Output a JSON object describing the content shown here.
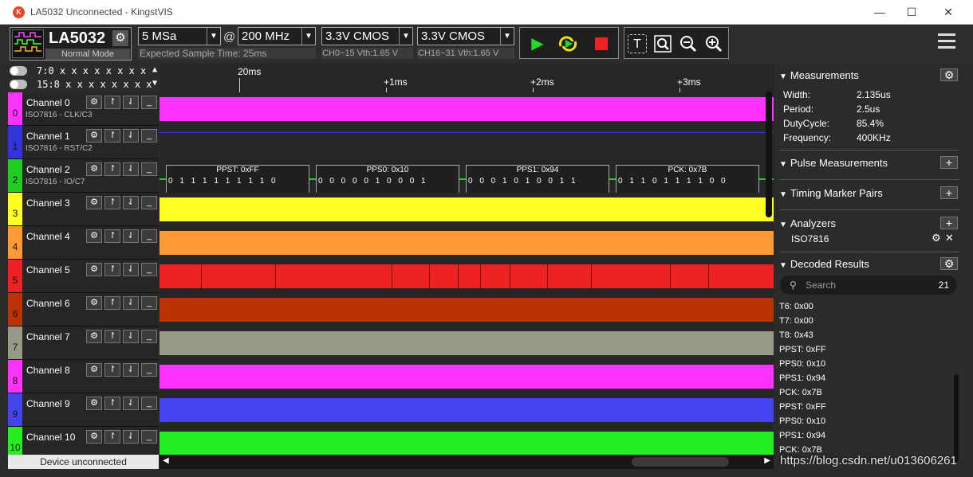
{
  "window": {
    "title": "LA5032 Unconnected - KingstVIS"
  },
  "toolbar": {
    "device": {
      "name": "LA5032",
      "mode": "Normal Mode"
    },
    "sample_depth": "5 MSa",
    "at": "@",
    "sample_rate": "200 MHz",
    "expected_time": "Expected Sample Time: 25ms",
    "threshold1": "3.3V CMOS",
    "threshold1_sub": "CH0~15 Vth:1.65 V",
    "threshold2": "3.3V CMOS",
    "threshold2_sub": "CH16~31 Vth:1.65 V"
  },
  "toggles": [
    {
      "label": "7:0 x x x x x x x x",
      "arrow": "▲"
    },
    {
      "label": "15:8 x x x x x x x x",
      "arrow": "▼"
    }
  ],
  "channels": [
    {
      "num": "0",
      "name": "Channel 0",
      "proto": "ISO7816 - CLK/C3",
      "color": "#ff33ff"
    },
    {
      "num": "1",
      "name": "Channel 1",
      "proto": "ISO7816 - RST/C2",
      "color": "#3333dd"
    },
    {
      "num": "2",
      "name": "Channel 2",
      "proto": "ISO7816 - IO/C7",
      "color": "#22cc22"
    },
    {
      "num": "3",
      "name": "Channel 3",
      "proto": "",
      "color": "#ffff22"
    },
    {
      "num": "4",
      "name": "Channel 4",
      "proto": "",
      "color": "#ff9933"
    },
    {
      "num": "5",
      "name": "Channel 5",
      "proto": "",
      "color": "#ee2222"
    },
    {
      "num": "6",
      "name": "Channel 6",
      "proto": "",
      "color": "#bb3300"
    },
    {
      "num": "7",
      "name": "Channel 7",
      "proto": "",
      "color": "#999988"
    },
    {
      "num": "8",
      "name": "Channel 8",
      "proto": "",
      "color": "#ff33ff"
    },
    {
      "num": "9",
      "name": "Channel 9",
      "proto": "",
      "color": "#4444ee"
    },
    {
      "num": "10",
      "name": "Channel 10",
      "proto": "",
      "color": "#22ee22"
    }
  ],
  "status": "Device unconnected",
  "timeline": {
    "ticks": [
      "20ms",
      "+1ms",
      "+2ms",
      "+3ms"
    ]
  },
  "frames": [
    {
      "label": "PPST: 0xFF",
      "bits": "0 1 1 1 1 1 1 1 1 0"
    },
    {
      "label": "PPS0: 0x10",
      "bits": "0 0 0 0 0 1 0 0 0 1"
    },
    {
      "label": "PPS1: 0x94",
      "bits": "0 0 0 1 0 1 0 0 1 1"
    },
    {
      "label": "PCK: 0x7B",
      "bits": "0 1 1 0 1 1 1 1 0 0"
    }
  ],
  "measurements": {
    "title": "Measurements",
    "rows": [
      {
        "k": "Width:",
        "v": "2.135us"
      },
      {
        "k": "Period:",
        "v": "2.5us"
      },
      {
        "k": "DutyCycle:",
        "v": "85.4%"
      },
      {
        "k": "Frequency:",
        "v": "400KHz"
      }
    ]
  },
  "pulse": {
    "title": "Pulse Measurements"
  },
  "timing": {
    "title": "Timing Marker Pairs"
  },
  "analyzers": {
    "title": "Analyzers",
    "item": "ISO7816"
  },
  "decoded": {
    "title": "Decoded Results",
    "search_placeholder": "Search",
    "count": "21",
    "results": [
      "T6: 0x00",
      "T7: 0x00",
      "T8: 0x43",
      "PPST: 0xFF",
      "PPS0: 0x10",
      "PPS1: 0x94",
      "PCK: 0x7B",
      "PPST: 0xFF",
      "PPS0: 0x10",
      "PPS1: 0x94",
      "PCK: 0x7B"
    ]
  },
  "watermark": "https://blog.csdn.net/u013606261"
}
